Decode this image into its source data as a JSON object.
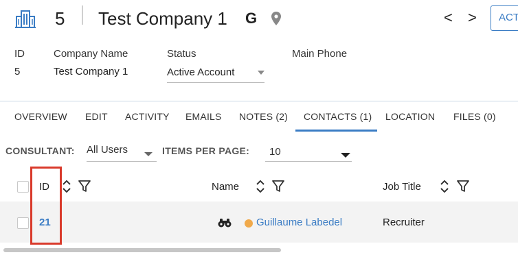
{
  "header": {
    "record_id": "5",
    "company_title": "Test Company 1",
    "g_badge": "G",
    "prev_symbol": "<",
    "next_symbol": ">",
    "action_label": "ACT",
    "icons": [
      "building-icon",
      "location-pin-icon"
    ]
  },
  "summary": {
    "id_label": "ID",
    "id_value": "5",
    "company_name_label": "Company Name",
    "company_name_value": "Test Company 1",
    "status_label": "Status",
    "status_value": "Active Account",
    "main_phone_label": "Main Phone",
    "main_phone_value": ""
  },
  "tabs": [
    {
      "label": "OVERVIEW"
    },
    {
      "label": "EDIT"
    },
    {
      "label": "ACTIVITY"
    },
    {
      "label": "EMAILS"
    },
    {
      "label": "NOTES (2)"
    },
    {
      "label": "CONTACTS (1)"
    },
    {
      "label": "LOCATION"
    },
    {
      "label": "FILES (0)"
    }
  ],
  "active_tab": "CONTACTS (1)",
  "filters": {
    "consultant_label": "CONSULTANT:",
    "consultant_value": "All Users",
    "items_per_page_label": "ITEMS PER PAGE:",
    "items_per_page_value": "10"
  },
  "table": {
    "columns": [
      {
        "label": "ID"
      },
      {
        "label": "Name"
      },
      {
        "label": "Job Title"
      }
    ],
    "rows": [
      {
        "id": "21",
        "name": "Guillaume Labedel",
        "job_title": "Recruiter",
        "status_color": "#f0a94a"
      }
    ]
  },
  "colors": {
    "accent": "#3a7cc4",
    "highlight": "#d93a2b"
  }
}
